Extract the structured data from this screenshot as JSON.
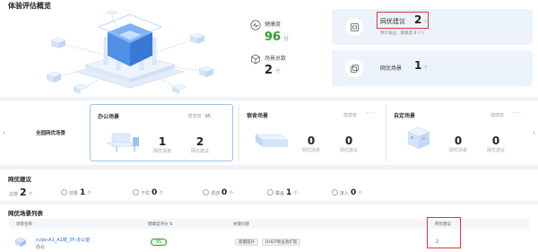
{
  "overview": {
    "title": "体验评估概览",
    "health": {
      "label": "健康度",
      "value": "96",
      "unit": "分"
    },
    "scenario_total": {
      "label": "场景总数",
      "value": "2",
      "unit": "个"
    }
  },
  "suggestion_card": {
    "label": "网优建议",
    "value": "2",
    "unit": "个",
    "sub": "预计收益：健康度",
    "sub_value": "0",
    "sub_unit": "(↑)"
  },
  "scenario_card": {
    "label": "网优场景",
    "value": "1",
    "unit": "个"
  },
  "strip": {
    "left_label": "全园网优场景",
    "prev_icon": "‹",
    "next_icon": "›",
    "scenarios": [
      {
        "name": "办公场景",
        "health_label": "健康度",
        "health_value": "95",
        "scenes": "1",
        "scenes_label": "网优场景",
        "suggestions": "2",
        "suggestions_label": "网优建议",
        "more": "···"
      },
      {
        "name": "宿舍场景",
        "health_label": "健康度",
        "health_value": "",
        "scenes": "0",
        "scenes_label": "网优场景",
        "suggestions": "0",
        "suggestions_label": "网优建议",
        "more": "···"
      },
      {
        "name": "自定场景",
        "health_label": "健康度",
        "health_value": "",
        "scenes": "0",
        "scenes_label": "网优场景",
        "suggestions": "0",
        "suggestions_label": "网优建议",
        "more": "···"
      }
    ]
  },
  "suggestions": {
    "title": "网优建议",
    "total_label": "总数",
    "total": "2",
    "total_unit": "个",
    "items": [
      {
        "label": "容量",
        "value": "1",
        "unit": "个"
      },
      {
        "label": "干扰",
        "value": "0",
        "unit": "个"
      },
      {
        "label": "漫游",
        "value": "0",
        "unit": "个"
      },
      {
        "label": "覆盖",
        "value": "1",
        "unit": "个"
      },
      {
        "label": "接入",
        "value": "0",
        "unit": "个"
      }
    ]
  },
  "table": {
    "title": "网优场景列表",
    "columns": [
      "场景名称",
      "健康度评分 ⇅",
      "关键问题",
      "网优建议"
    ],
    "rows": [
      {
        "name": "ruijie-A1_A1楼_3F-办公室",
        "type": "办公",
        "score": "95",
        "issues": [
          "容量提升",
          "DHCP地址池扩容"
        ],
        "suggestions": "2"
      }
    ]
  },
  "colors": {
    "accent": "#2a6fdb",
    "health_green": "#2a9d2a",
    "highlight_red": "#e0343b",
    "card_blue": "#edf3fb"
  }
}
